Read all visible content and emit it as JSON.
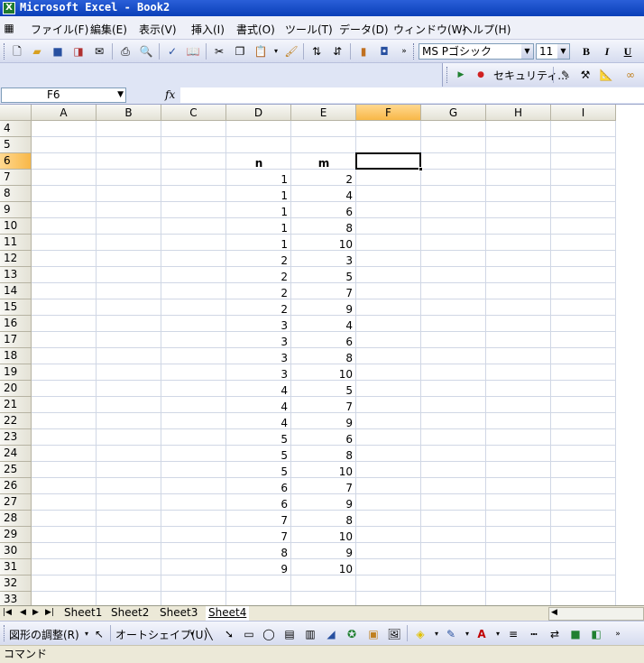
{
  "window": {
    "title": "Microsoft Excel - Book2",
    "app_icon": "excel-icon"
  },
  "menu": {
    "items": [
      "ファイル(F)",
      "編集(E)",
      "表示(V)",
      "挿入(I)",
      "書式(O)",
      "ツール(T)",
      "データ(D)",
      "ウィンドウ(W)",
      "ヘルプ(H)"
    ]
  },
  "toolbar": {
    "font_name": "MS Pゴシック",
    "font_size": "11",
    "bold": "B",
    "italic": "I",
    "underline": "U",
    "security_label": "セキュリティ..."
  },
  "formula_bar": {
    "name_box": "F6",
    "fx_label": "fx",
    "formula": ""
  },
  "columns": [
    "A",
    "B",
    "C",
    "D",
    "E",
    "F",
    "G",
    "H",
    "I"
  ],
  "selected_column": "F",
  "selected_row": "6",
  "rows": [
    "4",
    "5",
    "6",
    "7",
    "8",
    "9",
    "10",
    "11",
    "12",
    "13",
    "14",
    "15",
    "16",
    "17",
    "18",
    "19",
    "20",
    "21",
    "22",
    "23",
    "24",
    "25",
    "26",
    "27",
    "28",
    "29",
    "30",
    "31",
    "32",
    "33"
  ],
  "table": {
    "headers": {
      "D": "n",
      "E": "m"
    },
    "n": [
      "1",
      "1",
      "1",
      "1",
      "1",
      "2",
      "2",
      "2",
      "2",
      "3",
      "3",
      "3",
      "3",
      "4",
      "4",
      "4",
      "5",
      "5",
      "5",
      "6",
      "6",
      "7",
      "7",
      "8",
      "9"
    ],
    "m": [
      "2",
      "4",
      "6",
      "8",
      "10",
      "3",
      "5",
      "7",
      "9",
      "4",
      "6",
      "8",
      "10",
      "5",
      "7",
      "9",
      "6",
      "8",
      "10",
      "7",
      "9",
      "8",
      "10",
      "9",
      "10"
    ]
  },
  "sheets": {
    "tabs": [
      "Sheet1",
      "Sheet2",
      "Sheet3",
      "Sheet4"
    ],
    "active": "Sheet4"
  },
  "drawing_toolbar": {
    "draw_label": "図形の調整(R)",
    "autoshape_label": "オートシェイプ(U)"
  },
  "status_bar": {
    "mode": "コマンド"
  }
}
